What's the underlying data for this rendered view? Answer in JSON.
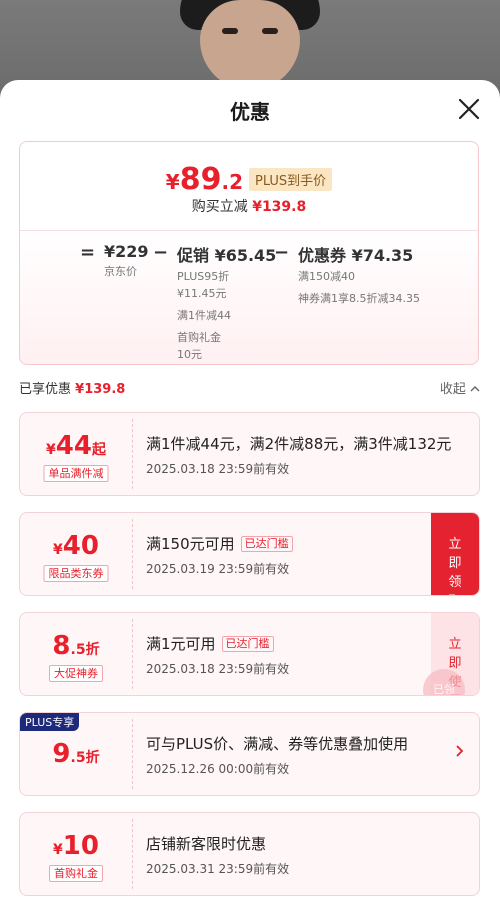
{
  "sheet": {
    "title": "优惠"
  },
  "summary": {
    "price_symbol": "¥",
    "price_int": "89",
    "price_dec": ".2",
    "price_tag": "PLUS到手价",
    "saved_label": "购买立减",
    "saved_amount": "¥139.8",
    "eq": "=",
    "minus": "−",
    "minus2": "−",
    "jd": {
      "value": "¥229",
      "label": "京东价"
    },
    "promo": {
      "value": "促销 ¥65.45",
      "lines": [
        "PLUS95折",
        "¥11.45元",
        "满1件减44",
        "首购礼金",
        "10元"
      ]
    },
    "coupon": {
      "value": "优惠券 ¥74.35",
      "lines": [
        "满150减40",
        "神券满1享8.5折减34.35"
      ]
    }
  },
  "enjoyed": {
    "label": "已享优惠",
    "amount": "¥139.8",
    "collapse": "收起"
  },
  "coupons": [
    {
      "sym": "¥",
      "big": "44",
      "small": "起",
      "tag": "单品满件减",
      "desc": "满1件减44元，满2件减88元，满3件减132元",
      "date": "2025.03.18  23:59前有效"
    },
    {
      "sym": "¥",
      "big": "40",
      "small": "",
      "tag": "限品类东券",
      "desc": "满150元可用",
      "reached": "已达门槛",
      "date": "2025.03.19  23:59前有效",
      "action": "立即领取"
    },
    {
      "sym": "",
      "big": "8",
      "small": ".5折",
      "tag": "大促神券",
      "desc": "满1元可用",
      "reached": "已达门槛",
      "date": "2025.03.18  23:59前有效",
      "action": "立即使用",
      "stamp": "已领"
    },
    {
      "badge": "PLUS专享",
      "sym": "",
      "big": "9",
      "small": ".5折",
      "desc": "可与PLUS价、满减、券等优惠叠加使用",
      "date": "2025.12.26  00:00前有效"
    },
    {
      "sym": "¥",
      "big": "10",
      "small": "",
      "tag": "首购礼金",
      "desc": "店铺新客限时优惠",
      "date": "2025.03.31  23:59前有效"
    }
  ],
  "colors": {
    "accent": "#e8202c",
    "plus_badge": "#1d2a7a",
    "card_bg": "#fff6f7"
  }
}
